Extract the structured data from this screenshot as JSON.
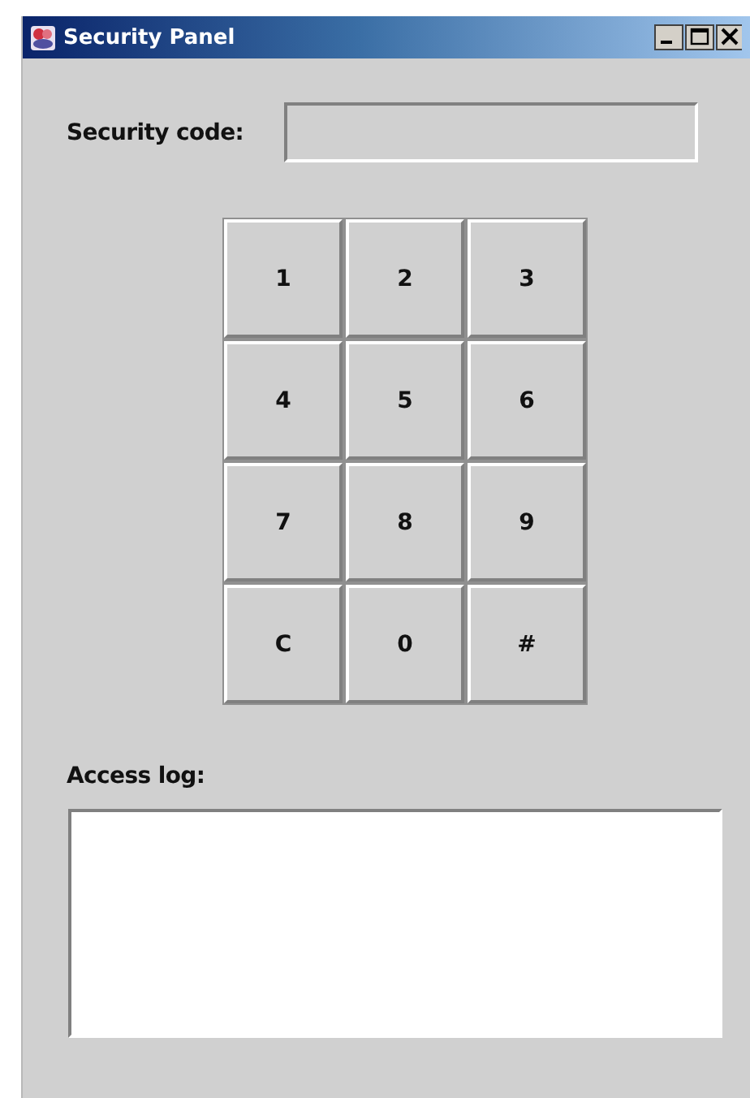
{
  "window": {
    "title": "Security Panel"
  },
  "code_field": {
    "label": "Security code:",
    "disabled": true
  },
  "keypad": [
    "1",
    "2",
    "3",
    "4",
    "5",
    "6",
    "7",
    "8",
    "9",
    "C",
    "0",
    "#"
  ],
  "access_log": {
    "label": "Access log:"
  }
}
